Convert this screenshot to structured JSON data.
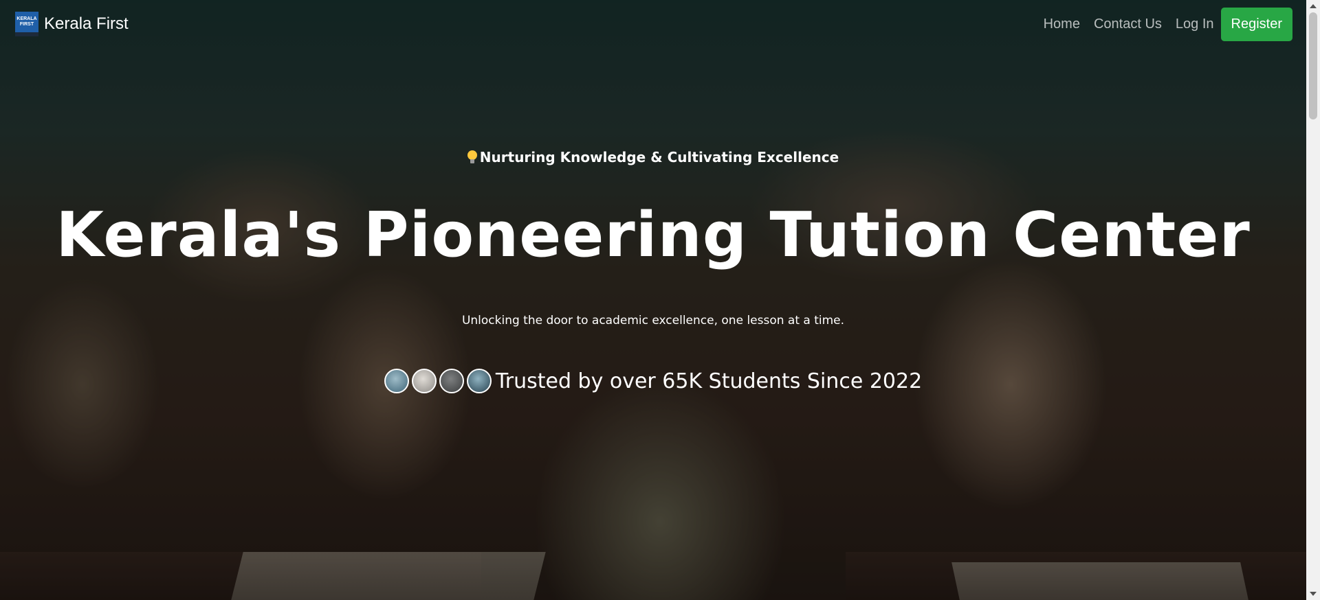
{
  "navbar": {
    "brand_name": "Kerala First",
    "logo_text_line1": "KERALA",
    "logo_text_line2": "FIRST",
    "links": [
      {
        "label": "Home"
      },
      {
        "label": "Contact Us"
      },
      {
        "label": "Log In"
      }
    ],
    "register_label": "Register"
  },
  "hero": {
    "tagline_icon": "lightbulb-icon",
    "tagline": "Nurturing Knowledge & Cultivating Excellence",
    "headline": "Kerala's Pioneering Tution Center",
    "subtitle": "Unlocking the door to academic excellence, one lesson at a time.",
    "trust_text": "Trusted by over 65K Students Since 2022",
    "avatar_count": 4
  },
  "colors": {
    "register_button": "#28a745",
    "text": "#ffffff",
    "nav_link": "rgba(255,255,255,0.7)"
  }
}
